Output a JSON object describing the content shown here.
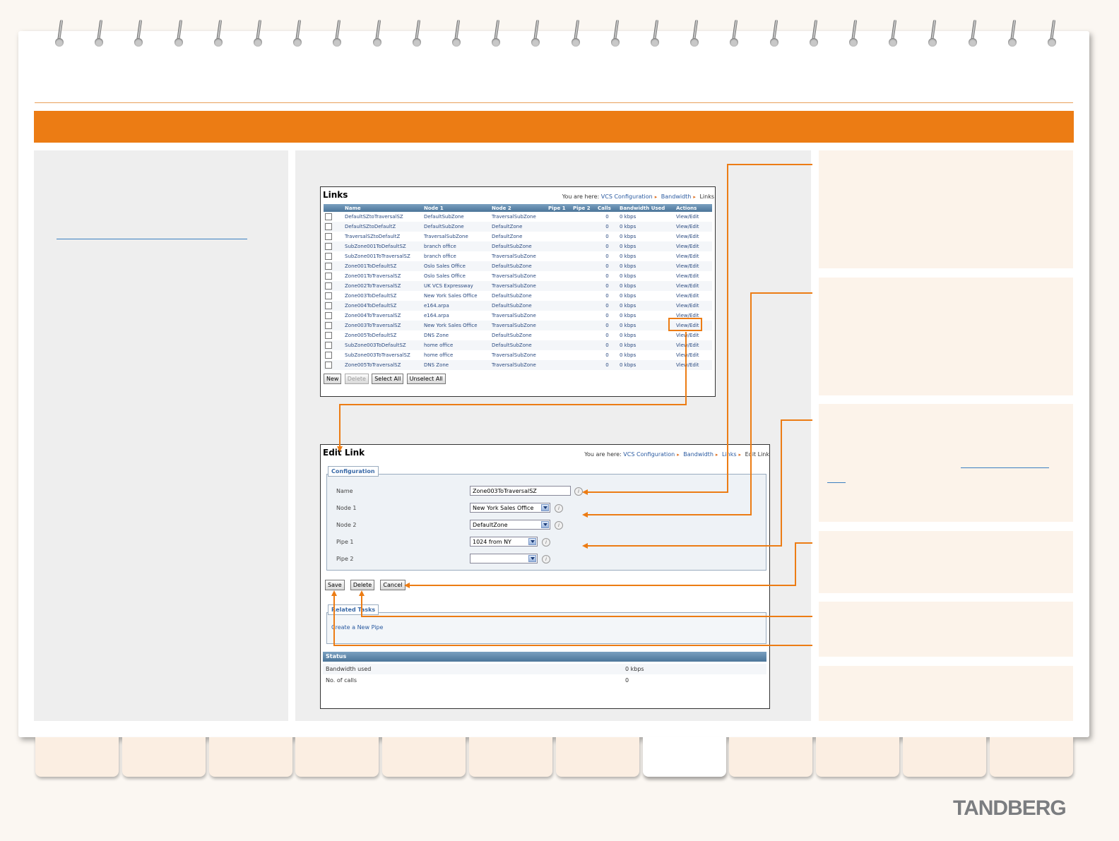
{
  "brand": {
    "logo": "TANDBERG",
    "accent": "#ec7c14"
  },
  "links_screen": {
    "title": "Links",
    "breadcrumb": {
      "prefix": "You are here:",
      "items": [
        "VCS Configuration",
        "Bandwidth",
        "Links"
      ]
    },
    "columns": [
      "Name",
      "Node 1",
      "Node 2",
      "Pipe 1",
      "Pipe 2",
      "Calls",
      "Bandwidth Used",
      "Actions"
    ],
    "rows": [
      [
        "DefaultSZtoTraversalSZ",
        "DefaultSubZone",
        "TraversalSubZone",
        "",
        "",
        "0",
        "0 kbps",
        "View/Edit"
      ],
      [
        "DefaultSZtoDefaultZ",
        "DefaultSubZone",
        "DefaultZone",
        "",
        "",
        "0",
        "0 kbps",
        "View/Edit"
      ],
      [
        "TraversalSZtoDefaultZ",
        "TraversalSubZone",
        "DefaultZone",
        "",
        "",
        "0",
        "0 kbps",
        "View/Edit"
      ],
      [
        "SubZone001ToDefaultSZ",
        "branch office",
        "DefaultSubZone",
        "",
        "",
        "0",
        "0 kbps",
        "View/Edit"
      ],
      [
        "SubZone001ToTraversalSZ",
        "branch office",
        "TraversalSubZone",
        "",
        "",
        "0",
        "0 kbps",
        "View/Edit"
      ],
      [
        "Zone001ToDefaultSZ",
        "Oslo Sales Office",
        "DefaultSubZone",
        "",
        "",
        "0",
        "0 kbps",
        "View/Edit"
      ],
      [
        "Zone001ToTraversalSZ",
        "Oslo Sales Office",
        "TraversalSubZone",
        "",
        "",
        "0",
        "0 kbps",
        "View/Edit"
      ],
      [
        "Zone002ToTraversalSZ",
        "UK VCS Expressway",
        "TraversalSubZone",
        "",
        "",
        "0",
        "0 kbps",
        "View/Edit"
      ],
      [
        "Zone003ToDefaultSZ",
        "New York Sales Office",
        "DefaultSubZone",
        "",
        "",
        "0",
        "0 kbps",
        "View/Edit"
      ],
      [
        "Zone004ToDefaultSZ",
        "e164.arpa",
        "DefaultSubZone",
        "",
        "",
        "0",
        "0 kbps",
        "View/Edit"
      ],
      [
        "Zone004ToTraversalSZ",
        "e164.arpa",
        "TraversalSubZone",
        "",
        "",
        "0",
        "0 kbps",
        "View/Edit"
      ],
      [
        "Zone003ToTraversalSZ",
        "New York Sales Office",
        "TraversalSubZone",
        "",
        "",
        "0",
        "0 kbps",
        "View/Edit"
      ],
      [
        "Zone005ToDefaultSZ",
        "DNS Zone",
        "DefaultSubZone",
        "",
        "",
        "0",
        "0 kbps",
        "View/Edit"
      ],
      [
        "SubZone003ToDefaultSZ",
        "home office",
        "DefaultSubZone",
        "",
        "",
        "0",
        "0 kbps",
        "View/Edit"
      ],
      [
        "SubZone003ToTraversalSZ",
        "home office",
        "TraversalSubZone",
        "",
        "",
        "0",
        "0 kbps",
        "View/Edit"
      ],
      [
        "Zone005ToTraversalSZ",
        "DNS Zone",
        "TraversalSubZone",
        "",
        "",
        "0",
        "0 kbps",
        "View/Edit"
      ]
    ],
    "buttons": {
      "new": "New",
      "delete": "Delete",
      "select_all": "Select All",
      "unselect_all": "Unselect All"
    }
  },
  "edit_screen": {
    "title": "Edit Link",
    "breadcrumb": {
      "prefix": "You are here:",
      "items": [
        "VCS Configuration",
        "Bandwidth",
        "Links",
        "Edit Link"
      ]
    },
    "config_legend": "Configuration",
    "fields": {
      "name": {
        "label": "Name",
        "value": "Zone003ToTraversalSZ"
      },
      "node1": {
        "label": "Node 1",
        "value": "New York Sales Office"
      },
      "node2": {
        "label": "Node 2",
        "value": "DefaultZone"
      },
      "pipe1": {
        "label": "Pipe 1",
        "value": "1024 from NY"
      },
      "pipe2": {
        "label": "Pipe 2",
        "value": ""
      }
    },
    "buttons": {
      "save": "Save",
      "delete": "Delete",
      "cancel": "Cancel"
    },
    "related": {
      "legend": "Related Tasks",
      "link": "Create a New Pipe"
    },
    "status": {
      "header": "Status",
      "bandwidth_label": "Bandwidth used",
      "bandwidth_value": "0 kbps",
      "calls_label": "No. of calls",
      "calls_value": "0"
    }
  }
}
